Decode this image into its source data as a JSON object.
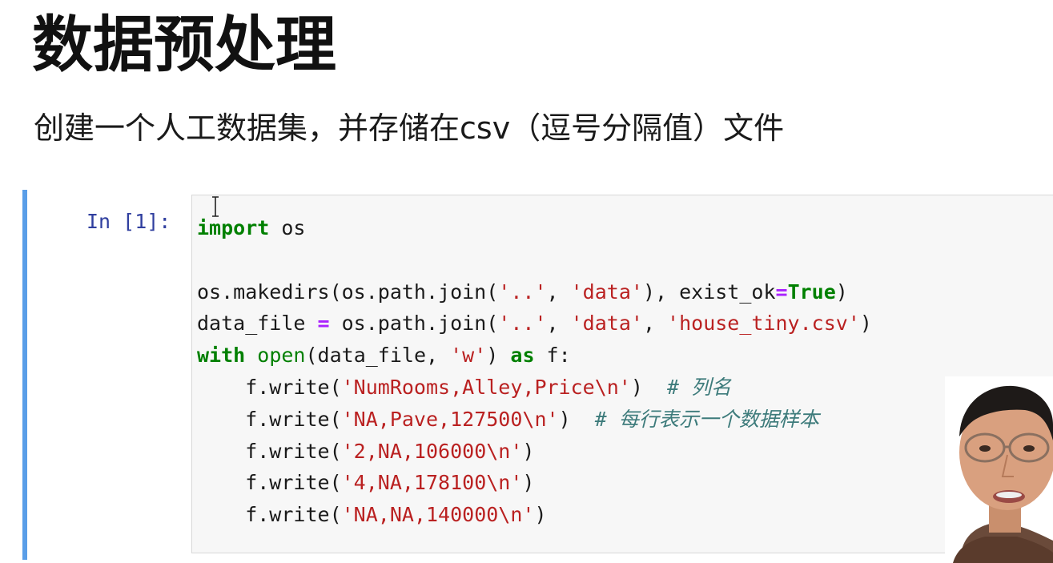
{
  "slide": {
    "title": "数据预处理",
    "subtitle": "创建一个人工数据集，并存储在csv（逗号分隔值）文件"
  },
  "cell": {
    "prompt": "In [1]:",
    "lines": [
      [
        {
          "t": "import",
          "c": "kw"
        },
        {
          "t": " os",
          "c": ""
        }
      ],
      [],
      [
        {
          "t": "os.makedirs(os.path.join(",
          "c": ""
        },
        {
          "t": "'..'",
          "c": "st"
        },
        {
          "t": ", ",
          "c": ""
        },
        {
          "t": "'data'",
          "c": "st"
        },
        {
          "t": "), exist_ok",
          "c": ""
        },
        {
          "t": "=",
          "c": "op"
        },
        {
          "t": "True",
          "c": "kw"
        },
        {
          "t": ")",
          "c": ""
        }
      ],
      [
        {
          "t": "data_file ",
          "c": ""
        },
        {
          "t": "=",
          "c": "op"
        },
        {
          "t": " os.path.join(",
          "c": ""
        },
        {
          "t": "'..'",
          "c": "st"
        },
        {
          "t": ", ",
          "c": ""
        },
        {
          "t": "'data'",
          "c": "st"
        },
        {
          "t": ", ",
          "c": ""
        },
        {
          "t": "'house_tiny.csv'",
          "c": "st"
        },
        {
          "t": ")",
          "c": ""
        }
      ],
      [
        {
          "t": "with",
          "c": "kw"
        },
        {
          "t": " ",
          "c": ""
        },
        {
          "t": "open",
          "c": "bi"
        },
        {
          "t": "(data_file, ",
          "c": ""
        },
        {
          "t": "'w'",
          "c": "st"
        },
        {
          "t": ") ",
          "c": ""
        },
        {
          "t": "as",
          "c": "kw"
        },
        {
          "t": " f:",
          "c": ""
        }
      ],
      [
        {
          "t": "    f.write(",
          "c": ""
        },
        {
          "t": "'NumRooms,Alley,Price\\n'",
          "c": "st"
        },
        {
          "t": ")  ",
          "c": ""
        },
        {
          "t": "# 列名",
          "c": "cm"
        }
      ],
      [
        {
          "t": "    f.write(",
          "c": ""
        },
        {
          "t": "'NA,Pave,127500\\n'",
          "c": "st"
        },
        {
          "t": ")  ",
          "c": ""
        },
        {
          "t": "# 每行表示一个数据样本",
          "c": "cm"
        }
      ],
      [
        {
          "t": "    f.write(",
          "c": ""
        },
        {
          "t": "'2,NA,106000\\n'",
          "c": "st"
        },
        {
          "t": ")",
          "c": ""
        }
      ],
      [
        {
          "t": "    f.write(",
          "c": ""
        },
        {
          "t": "'4,NA,178100\\n'",
          "c": "st"
        },
        {
          "t": ")",
          "c": ""
        }
      ],
      [
        {
          "t": "    f.write(",
          "c": ""
        },
        {
          "t": "'NA,NA,140000\\n'",
          "c": "st"
        },
        {
          "t": ")",
          "c": ""
        }
      ]
    ]
  },
  "colors": {
    "cell_border": "#5a9ee8",
    "prompt": "#303f9f",
    "keyword": "#008000",
    "string": "#ba2121",
    "comment": "#3d7b7b",
    "operator": "#aa22ff"
  }
}
